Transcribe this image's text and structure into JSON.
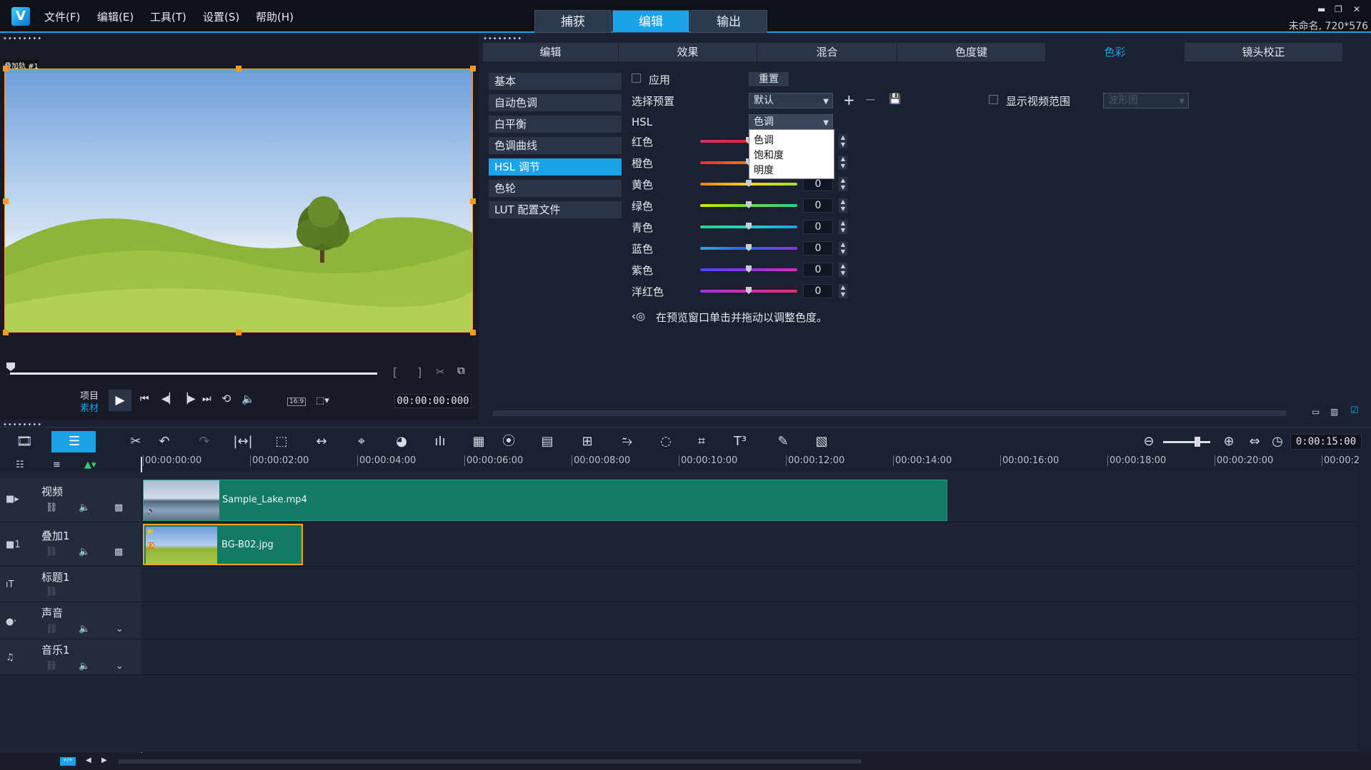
{
  "app": {
    "logo": "V",
    "project_info": "未命名, 720*576",
    "window_controls": [
      "▬",
      "❐",
      "✕"
    ]
  },
  "menu": [
    "文件(F)",
    "编辑(E)",
    "工具(T)",
    "设置(S)",
    "帮助(H)"
  ],
  "main_tabs": [
    {
      "label": "捕获",
      "active": false
    },
    {
      "label": "编辑",
      "active": true
    },
    {
      "label": "输出",
      "active": false
    }
  ],
  "preview": {
    "track_label": "叠加轨 #1",
    "mode_project": "项目",
    "mode_clip": "素材",
    "aspect": "16:9",
    "timecode": "00:00:00:000"
  },
  "settings": {
    "subtabs": [
      {
        "label": "编辑",
        "active": false
      },
      {
        "label": "效果",
        "active": false
      },
      {
        "label": "混合",
        "active": false
      },
      {
        "label": "色度键",
        "active": false
      },
      {
        "label": "色彩",
        "active": true
      },
      {
        "label": "镜头校正",
        "active": false
      }
    ],
    "nav": [
      {
        "label": "基本",
        "active": false
      },
      {
        "label": "自动色调",
        "active": false
      },
      {
        "label": "白平衡",
        "active": false
      },
      {
        "label": "色调曲线",
        "active": false
      },
      {
        "label": "HSL 调节",
        "active": true
      },
      {
        "label": "色轮",
        "active": false
      },
      {
        "label": "LUT 配置文件",
        "active": false
      }
    ],
    "apply_label": "应用",
    "reset_label": "重置",
    "preset_label": "选择预置",
    "preset_value": "默认",
    "hsl_label": "HSL",
    "hsl_value": "色调",
    "show_scope_label": "显示视频范围",
    "scope_value": "波形图",
    "hsl_options": [
      "色调",
      "饱和度",
      "明度"
    ],
    "colors": [
      {
        "label": "红色",
        "value": "0",
        "gradient": "linear-gradient(90deg,#c9366d,#e0282e,#e85b1a)"
      },
      {
        "label": "橙色",
        "value": "0",
        "gradient": "linear-gradient(90deg,#e2302a,#f07a12,#f5b51b)"
      },
      {
        "label": "黄色",
        "value": "0",
        "gradient": "linear-gradient(90deg,#f07f10,#f2d51a,#a4e224)"
      },
      {
        "label": "绿色",
        "value": "0",
        "gradient": "linear-gradient(90deg,#d4e01c,#5fe22e,#20d48d)"
      },
      {
        "label": "青色",
        "value": "0",
        "gradient": "linear-gradient(90deg,#26d67e,#20d3c6,#1f9be9)"
      },
      {
        "label": "蓝色",
        "value": "0",
        "gradient": "linear-gradient(90deg,#22a9e7,#2d5ff0,#8a35e6)"
      },
      {
        "label": "紫色",
        "value": "0",
        "gradient": "linear-gradient(90deg,#4447f0,#9a2fe6,#d62bc6)"
      },
      {
        "label": "洋红色",
        "value": "0",
        "gradient": "linear-gradient(90deg,#a82fe6,#df28b5,#e6306a)"
      }
    ],
    "hint": "在预览窗口单击并拖动以调整色度。"
  },
  "timeline": {
    "zoom_timecode": "0:00:15:00",
    "ruler": [
      "00:00:00:00",
      "00:00:02:00",
      "00:00:04:00",
      "00:00:06:00",
      "00:00:08:00",
      "00:00:10:00",
      "00:00:12:00",
      "00:00:14:00",
      "00:00:16:00",
      "00:00:18:00",
      "00:00:20:00",
      "00:00:2"
    ],
    "tracks": [
      {
        "name": "视频",
        "icon": "camera-icon"
      },
      {
        "name": "叠加1",
        "icon": "overlay-icon"
      },
      {
        "name": "标题1",
        "icon": "title-icon"
      },
      {
        "name": "声音",
        "icon": "voice-icon"
      },
      {
        "name": "音乐1",
        "icon": "music-icon"
      }
    ],
    "clips": {
      "video": "Sample_Lake.mp4",
      "overlay": "BG-B02.jpg"
    }
  }
}
